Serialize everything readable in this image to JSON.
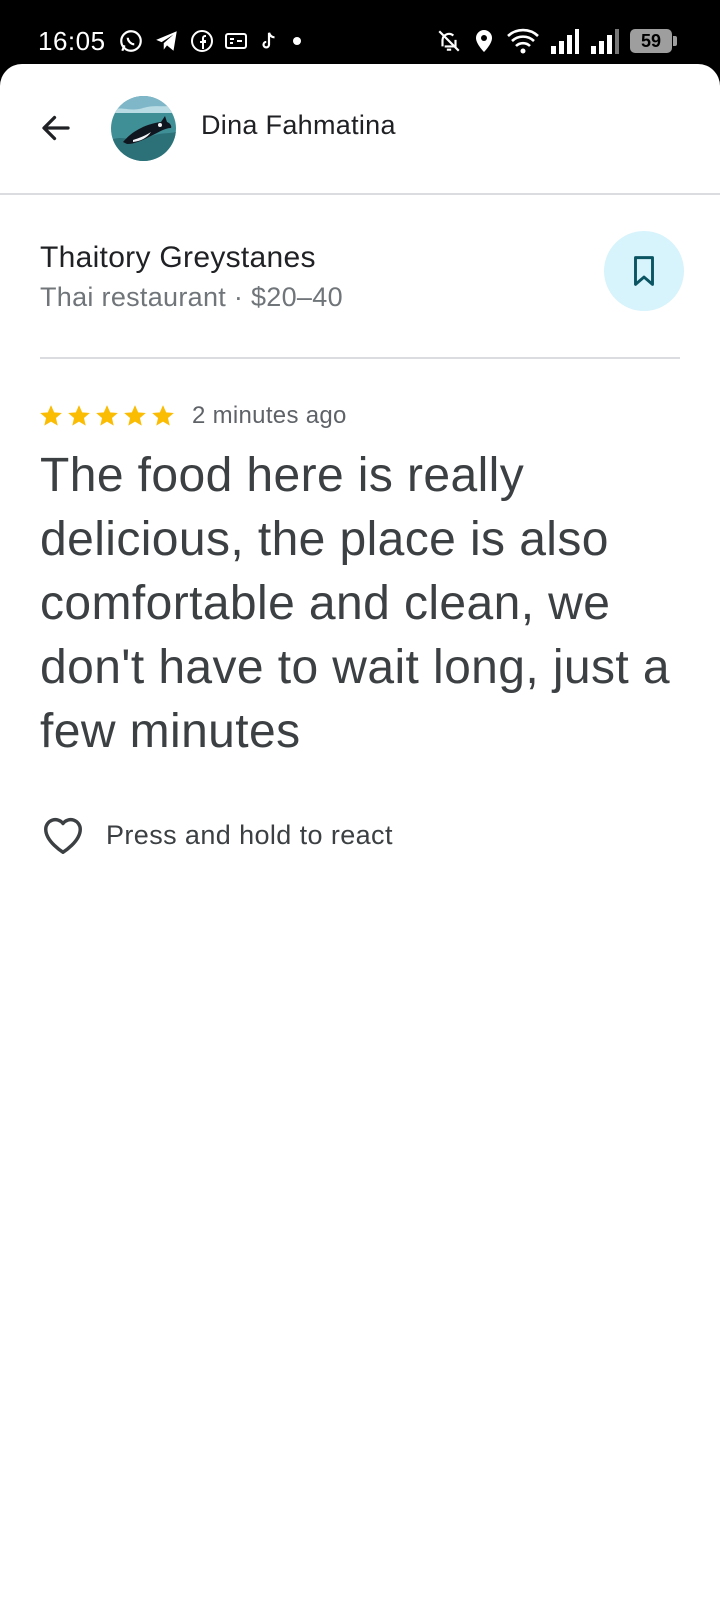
{
  "status_bar": {
    "time": "16:05",
    "battery_level": "59",
    "left_icons": [
      "whatsapp-icon",
      "telegram-icon",
      "facebook-icon",
      "card-icon",
      "tiktok-icon",
      "dot-icon"
    ],
    "right_icons": [
      "bell-off-icon",
      "location-icon",
      "wifi-icon",
      "signal-icon",
      "signal-icon",
      "battery-icon"
    ]
  },
  "header": {
    "author_name": "Dina Fahmatina"
  },
  "place": {
    "name": "Thaitory Greystanes",
    "meta": "Thai restaurant · $20–40"
  },
  "review": {
    "rating": 5,
    "rating_max": 5,
    "time_ago": "2 minutes ago",
    "text": "The food here is really delicious, the place is also comfortable and clean, we don't have to wait long, just a few minutes"
  },
  "reaction": {
    "label": "Press and hold to react"
  },
  "colors": {
    "star": "#fbbc04",
    "save_button_bg": "#d7f3fb",
    "primary_text": "#202124",
    "secondary_text": "#70757a"
  }
}
